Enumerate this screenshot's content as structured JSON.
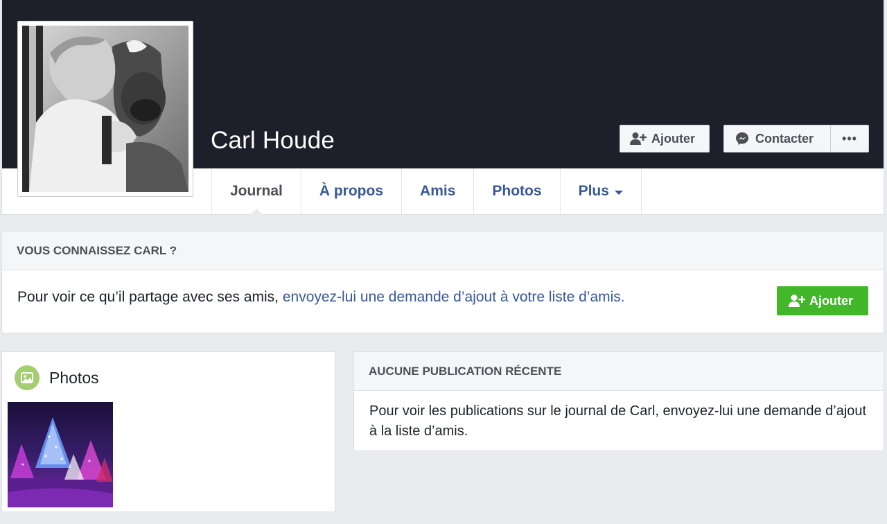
{
  "profile": {
    "name": "Carl Houde"
  },
  "cover_actions": {
    "add_label": "Ajouter",
    "contact_label": "Contacter",
    "more_label": "•••"
  },
  "tabs": [
    {
      "label": "Journal",
      "active": true
    },
    {
      "label": "À propos"
    },
    {
      "label": "Amis"
    },
    {
      "label": "Photos"
    },
    {
      "label": "Plus"
    }
  ],
  "know_card": {
    "heading": "VOUS CONNAISSEZ CARL ?",
    "text_plain": "Pour voir ce qu’il partage avec ses amis, ",
    "text_link": "envoyez-lui une demande d’ajout à votre liste d’amis.",
    "button_label": "Ajouter"
  },
  "photos_card": {
    "title": "Photos"
  },
  "posts_card": {
    "heading": "AUCUNE PUBLICATION RÉCENTE",
    "text": "Pour voir les publications sur le journal de Carl, envoyez-lui une demande d’ajout à la liste d’amis."
  },
  "colors": {
    "cover": "#1d202a",
    "link": "#365899",
    "green_button": "#42b72a",
    "page_bg": "#e9ebee",
    "photos_icon": "#a3ce71"
  },
  "icons": [
    "add-friend-icon",
    "messenger-icon",
    "photo-icon",
    "caret-down-icon"
  ]
}
